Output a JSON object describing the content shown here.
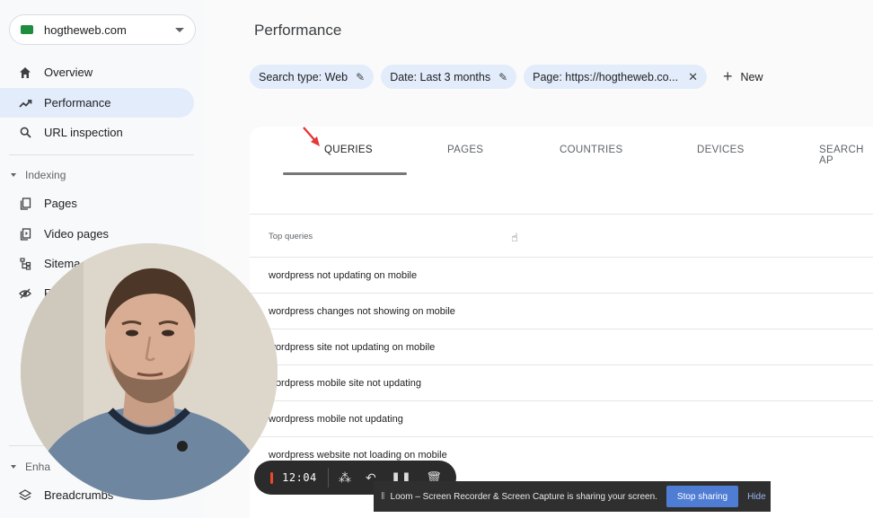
{
  "sidebar": {
    "property": "hogtheweb.com",
    "nav": [
      {
        "label": "Overview",
        "icon": "home-icon"
      },
      {
        "label": "Performance",
        "icon": "trending-icon"
      },
      {
        "label": "URL inspection",
        "icon": "search-icon"
      }
    ],
    "indexing_label": "Indexing",
    "indexing_items": [
      {
        "label": "Pages",
        "icon": "pages-icon"
      },
      {
        "label": "Video pages",
        "icon": "video-icon"
      },
      {
        "label": "Sitema",
        "icon": "sitemap-icon"
      },
      {
        "label": "R",
        "icon": "removals-icon"
      }
    ],
    "enhancements_label": "Enha",
    "enhancement_items": [
      {
        "label": "Breadcrumbs",
        "icon": "breadcrumbs-icon"
      }
    ]
  },
  "main": {
    "title": "Performance",
    "chips": [
      {
        "label": "Search type: Web",
        "action": "edit"
      },
      {
        "label": "Date: Last 3 months",
        "action": "edit"
      },
      {
        "label": "Page: https://hogtheweb.co...",
        "action": "remove"
      }
    ],
    "new_label": "New",
    "tabs": [
      "QUERIES",
      "PAGES",
      "COUNTRIES",
      "DEVICES",
      "SEARCH AP"
    ],
    "active_tab": "QUERIES",
    "table_header": "Top queries",
    "rows": [
      "wordpress not updating on mobile",
      "wordpress changes not showing on mobile",
      "wordpress site not updating on mobile",
      "wordpress mobile site not updating",
      "wordpress mobile not updating",
      "wordpress website not loading on mobile"
    ]
  },
  "recorder": {
    "time": "12:04",
    "stop_color": "#ea4a2a"
  },
  "sharing": {
    "message": "Loom – Screen Recorder & Screen Capture is sharing your screen.",
    "stop_label": "Stop sharing",
    "hide_label": "Hide"
  },
  "colors": {
    "accent_chip": "#e3ecfb",
    "arrow": "#e53935"
  }
}
